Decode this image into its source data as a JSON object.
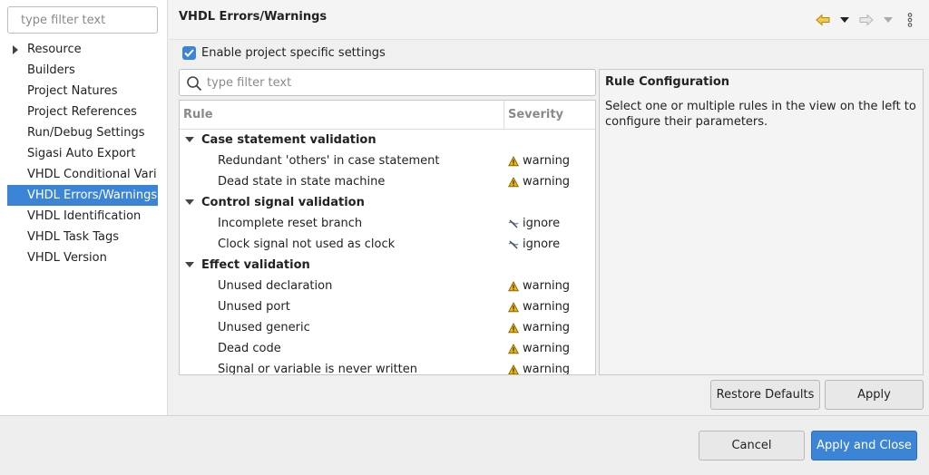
{
  "left": {
    "filter_placeholder": "type filter text",
    "items": [
      {
        "label": "Resource",
        "expandable": true
      },
      {
        "label": "Builders"
      },
      {
        "label": "Project Natures"
      },
      {
        "label": "Project References"
      },
      {
        "label": "Run/Debug Settings"
      },
      {
        "label": "Sigasi Auto Export"
      },
      {
        "label": "VHDL Conditional Vari"
      },
      {
        "label": "VHDL Errors/Warnings",
        "selected": true
      },
      {
        "label": "VHDL Identification"
      },
      {
        "label": "VHDL Task Tags"
      },
      {
        "label": "VHDL Version"
      }
    ]
  },
  "header": {
    "title": "VHDL Errors/Warnings",
    "icons": [
      "back-arrow-icon",
      "back-menu-chevron-icon",
      "forward-arrow-icon",
      "forward-menu-chevron-icon",
      "more-options-icon"
    ]
  },
  "enable": {
    "label": "Enable project specific settings",
    "checked": true
  },
  "rules": {
    "filter_placeholder": "type filter text",
    "col_rule": "Rule",
    "col_severity": "Severity",
    "groups": [
      {
        "label": "Case statement validation",
        "rules": [
          {
            "label": "Redundant 'others' in case statement",
            "severity": "warning"
          },
          {
            "label": "Dead state in state machine",
            "severity": "warning"
          }
        ]
      },
      {
        "label": "Control signal validation",
        "rules": [
          {
            "label": "Incomplete reset branch",
            "severity": "ignore"
          },
          {
            "label": "Clock signal not used as clock",
            "severity": "ignore"
          }
        ]
      },
      {
        "label": "Effect validation",
        "rules": [
          {
            "label": "Unused declaration",
            "severity": "warning"
          },
          {
            "label": "Unused port",
            "severity": "warning"
          },
          {
            "label": "Unused generic",
            "severity": "warning"
          },
          {
            "label": "Dead code",
            "severity": "warning"
          },
          {
            "label": "Signal or variable is never written",
            "severity": "warning"
          }
        ]
      }
    ]
  },
  "config": {
    "title": "Rule Configuration",
    "text": "Select one or multiple rules in the view on the left to configure their parameters."
  },
  "buttons": {
    "restore_defaults": "Restore Defaults",
    "apply": "Apply",
    "cancel": "Cancel",
    "apply_and_close": "Apply and Close"
  },
  "colors": {
    "accent": "#3b84d6",
    "warning": "#f0b400",
    "ignore": "#7d8aa8"
  }
}
